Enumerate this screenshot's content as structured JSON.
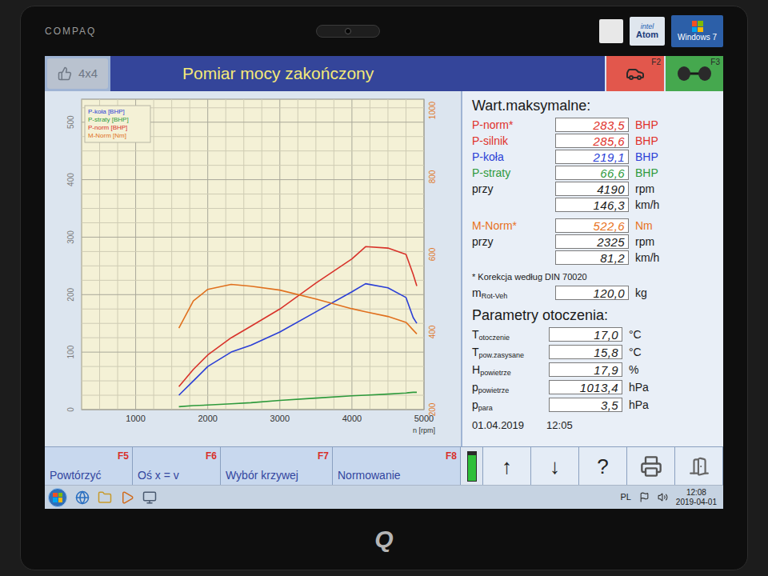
{
  "monitor": {
    "brand": "COMPAQ",
    "logo": "Q",
    "stickers": [
      {
        "kind": "energy",
        "lines": []
      },
      {
        "kind": "intel",
        "lines": [
          "intel",
          "Atom"
        ]
      },
      {
        "kind": "windows",
        "lines": [
          "Windows 7"
        ]
      }
    ]
  },
  "app": {
    "badge": "4x4",
    "title": "Pomiar mocy zakończony",
    "toolbar": [
      {
        "key": "F2",
        "kind": "car",
        "color": "#e2574c"
      },
      {
        "key": "F3",
        "kind": "axle",
        "color": "#45a84e"
      }
    ],
    "chart": {
      "x_axis": {
        "min": 250,
        "max": 5000,
        "ticks": [
          "1000",
          "2000",
          "3000",
          "4000",
          "5000"
        ],
        "label": "n [rpm]"
      },
      "left_axis": {
        "min": 0,
        "max": 540,
        "ticks": [
          "0",
          "100",
          "200",
          "300",
          "400",
          "500"
        ]
      },
      "right_axis": {
        "min": 200,
        "max": 1000,
        "ticks": [
          "200",
          "400",
          "600",
          "800",
          "1000"
        ]
      },
      "rpm": [
        1600,
        1800,
        2000,
        2325,
        2600,
        3000,
        3500,
        4000,
        4190,
        4500,
        4750,
        4850,
        4900
      ],
      "series": [
        {
          "label": "P-koła [BHP]",
          "axis": "left",
          "color": "#2b3fd6",
          "values": [
            25,
            50,
            75,
            100,
            112,
            135,
            170,
            205,
            219.1,
            212,
            195,
            160,
            150
          ]
        },
        {
          "label": "P-straty [BHP]",
          "axis": "left",
          "color": "#2e9a3c",
          "values": [
            5,
            7,
            8,
            10,
            12,
            16,
            20,
            24,
            25,
            27,
            29,
            30,
            30
          ]
        },
        {
          "label": "P-norm [BHP]",
          "axis": "left",
          "color": "#d8322a",
          "values": [
            40,
            70,
            95,
            125,
            145,
            175,
            220,
            262,
            283.5,
            281,
            270,
            235,
            215
          ]
        },
        {
          "label": "M-Norm [Nm]",
          "axis": "right",
          "color": "#e0701e",
          "values": [
            410,
            480,
            510,
            522.6,
            518,
            508,
            485,
            460,
            452,
            440,
            425,
            405,
            395
          ]
        }
      ]
    },
    "max_values": {
      "heading": "Wart.maksymalne:",
      "groups": [
        [
          {
            "label": "P-norm*",
            "value": "283,5",
            "unit": "BHP",
            "color": "#e0312b"
          },
          {
            "label": "P-silnik",
            "value": "285,6",
            "unit": "BHP",
            "color": "#e0312b"
          },
          {
            "label": "P-koła",
            "value": "219,1",
            "unit": "BHP",
            "color": "#2b3fd6"
          },
          {
            "label": "P-straty",
            "value": "66,6",
            "unit": "BHP",
            "color": "#2e9a3c"
          },
          {
            "label": "przy",
            "value": "4190",
            "unit": "rpm",
            "color": "#1a1a1a"
          },
          {
            "label": "",
            "value": "146,3",
            "unit": "km/h",
            "color": "#1a1a1a"
          }
        ],
        [
          {
            "label": "M-Norm*",
            "value": "522,6",
            "unit": "Nm",
            "color": "#e8721c"
          },
          {
            "label": "przy",
            "value": "2325",
            "unit": "rpm",
            "color": "#1a1a1a"
          },
          {
            "label": "",
            "value": "81,2",
            "unit": "km/h",
            "color": "#1a1a1a"
          }
        ]
      ],
      "note": "* Korekcja według DIN 70020",
      "rot": {
        "label": "m",
        "sub": "Rot-Veh",
        "value": "120,0",
        "unit": "kg"
      }
    },
    "ambient": {
      "heading": "Parametry otoczenia:",
      "rows": [
        {
          "label": "T",
          "sub": "otoczenie",
          "value": "17,0",
          "unit": "°C"
        },
        {
          "label": "T",
          "sub": "pow.zasysane",
          "value": "15,8",
          "unit": "°C"
        },
        {
          "label": "H",
          "sub": "powietrze",
          "value": "17,9",
          "unit": "%"
        },
        {
          "label": "p",
          "sub": "powietrze",
          "value": "1013,4",
          "unit": "hPa"
        },
        {
          "label": "p",
          "sub": "para",
          "value": "3,5",
          "unit": "hPa"
        }
      ]
    },
    "timestamp": {
      "date": "01.04.2019",
      "time": "12:05"
    },
    "fkeys": [
      {
        "label": "Powtórzyć",
        "key": "F5"
      },
      {
        "label": "Oś x = v",
        "key": "F6"
      },
      {
        "label": "Wybór krzywej",
        "key": "F7"
      },
      {
        "label": "Normowanie",
        "key": "F8"
      }
    ],
    "battery": {
      "level": 0.9
    },
    "nav": [
      {
        "kind": "glyph",
        "label": "↑"
      },
      {
        "kind": "glyph",
        "label": "↓"
      },
      {
        "kind": "glyph",
        "label": "?"
      },
      {
        "kind": "print",
        "label": ""
      },
      {
        "kind": "exit",
        "label": ""
      }
    ]
  },
  "taskbar": {
    "lang": "PL",
    "time": "12:08",
    "date": "2019-04-01"
  }
}
